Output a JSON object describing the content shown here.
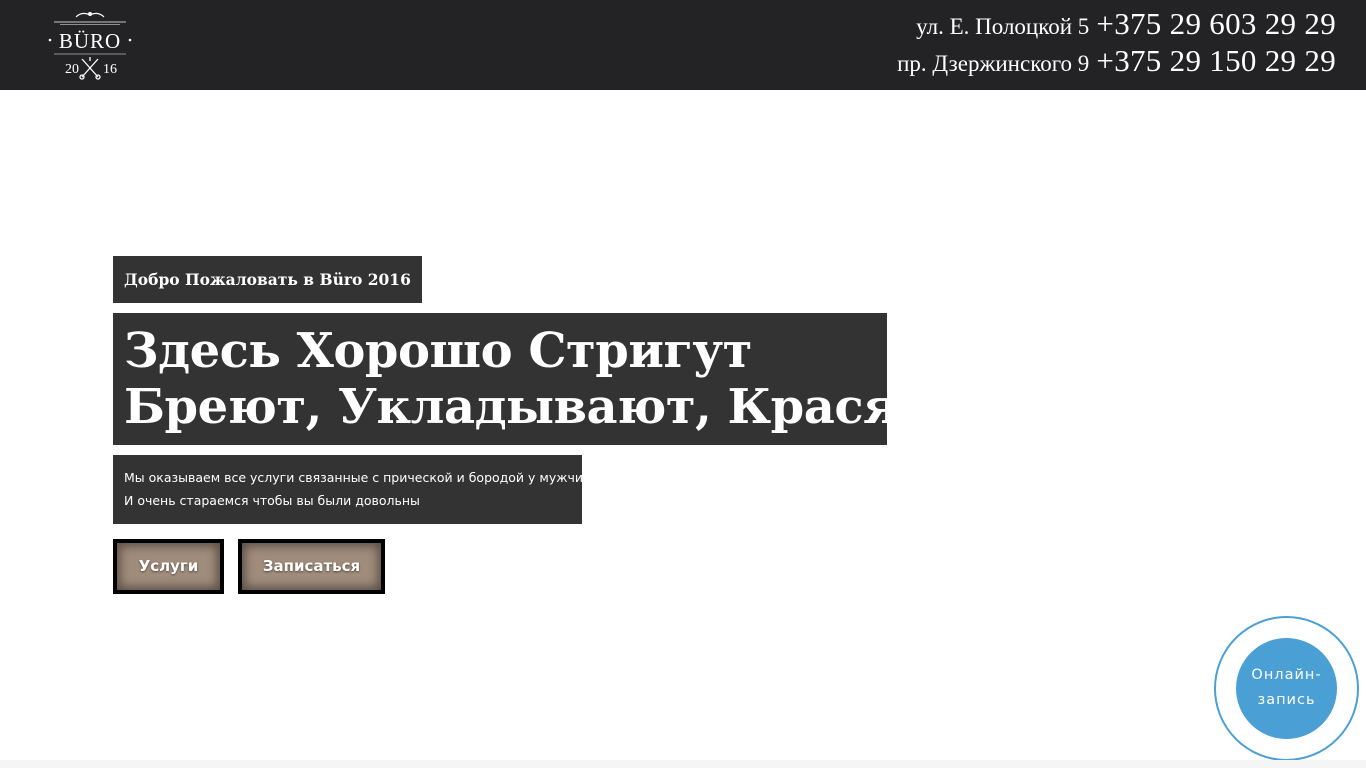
{
  "header": {
    "logo": {
      "name": "BÜRO",
      "year_left": "20",
      "year_right": "16",
      "icon": "crossed-scissors-icon"
    },
    "contacts": [
      {
        "address": "ул. Е. Полоцкой 5",
        "phone": "+375 29 603 29 29"
      },
      {
        "address": "пр. Дзержинского 9",
        "phone": "+375 29 150 29 29"
      }
    ]
  },
  "hero": {
    "welcome": "Добро Пожаловать в Büro 2016",
    "headline_line1": "Здесь Хорошо Стригут",
    "headline_line2": "Бреют, Укладывают, Красят",
    "description_line1": "Мы оказываем все услуги связанные с прической и бородой у мужчин.",
    "description_line2": "И очень стараемся чтобы вы были довольны",
    "services_button": "Услуги",
    "book_button": "Записаться"
  },
  "online_booking": {
    "line1": "Онлайн-",
    "line2": "запись"
  },
  "colors": {
    "header_bg": "#232326",
    "panel_bg": "#333333",
    "button_bg": "#a08c7b",
    "accent_blue": "#4a9fd4"
  }
}
